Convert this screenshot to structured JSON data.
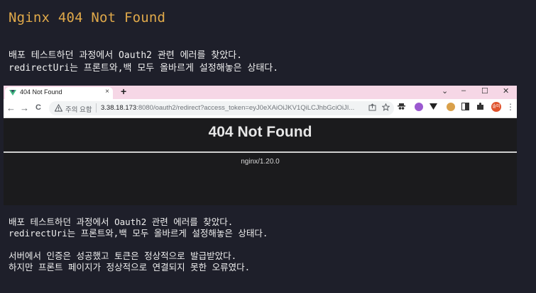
{
  "title": "Nginx 404 Not Found",
  "intro": {
    "line1": "배포 테스트하던 과정에서 Oauth2 관련 에러를 찾았다.",
    "line2": "redirectUri는 프론트와,백 모두 올바르게 설정해놓은 상태다."
  },
  "browser": {
    "tab_title": "404 Not Found",
    "tab_close": "×",
    "new_tab": "+",
    "window_controls": [
      "⌄",
      "–",
      "☐",
      "✕"
    ],
    "nav": {
      "back": "←",
      "forward": "→",
      "reload": "C"
    },
    "security_warning": "주의 요함",
    "url_host": "3.38.18.173",
    "url_rest": ":8080/oauth2/redirect?access_token=eyJ0eXAiOiJKV1QiLCJhbGciOiJI...",
    "omnibox_icons": [
      "share-icon",
      "star-icon"
    ],
    "extension_icons": [
      "spy-icon",
      "purple-ext-icon",
      "v-ext-icon",
      "cookie-icon",
      "sidebar-icon",
      "puzzle-icon",
      "profile-icon"
    ],
    "profile_label": "솔미",
    "colors": {
      "tab_bar": "#f6d7e6",
      "page_bg": "#1b1b1d"
    }
  },
  "page404": {
    "heading": "404 Not Found",
    "server": "nginx/1.20.0"
  },
  "body": {
    "para1_line1": "배포 테스트하던 과정에서 Oauth2 관련 에러를 찾았다.",
    "para1_line2": "redirectUri는 프론트와,백 모두 올바르게 설정해놓은 상태다.",
    "para2_line1": "서버에서 인증은 성공했고 토큰은 정상적으로 발급받았다.",
    "para2_line2": "하지만 프론트 페이지가 정상적으로 연결되지 못한 오류였다."
  },
  "colors": {
    "background": "#1e1f2a",
    "title": "#e0a94a",
    "text": "#efefef"
  }
}
